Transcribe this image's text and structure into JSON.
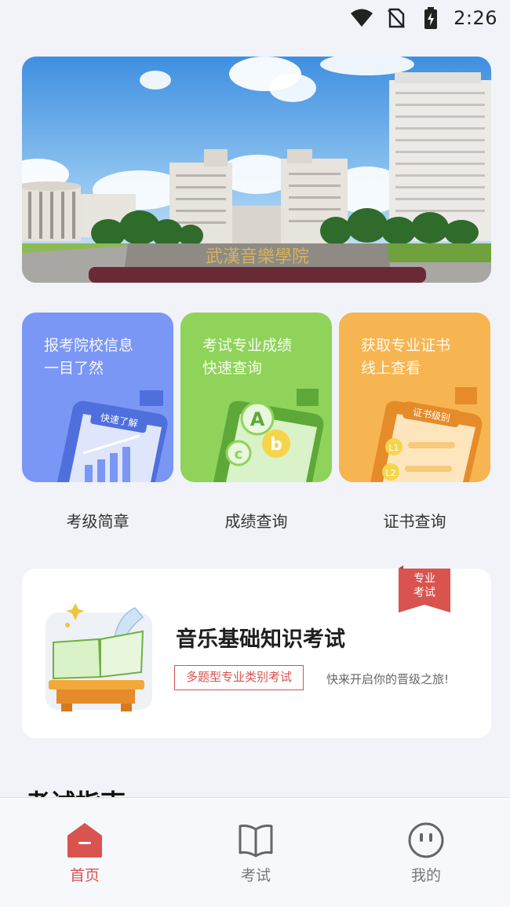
{
  "status_bar": {
    "time": "2:26",
    "icons": [
      "wifi-icon",
      "no-sim-icon",
      "battery-charging-icon"
    ]
  },
  "banner": {
    "sign_text": "武漢音樂學院"
  },
  "feature_cards": [
    {
      "text_line1": "报考院校信息",
      "text_line2": "一目了然",
      "badge": "快速了解",
      "label": "考级简章",
      "color": "#7b97f5"
    },
    {
      "text_line1": "考试专业成绩",
      "text_line2": "快速查询",
      "badge": "",
      "label": "成绩查询",
      "color": "#8fd35a"
    },
    {
      "text_line1": "获取专业证书",
      "text_line2": "线上查看",
      "badge": "证书级别",
      "label": "证书查询",
      "color": "#f6b551"
    }
  ],
  "exam_card": {
    "ribbon_line1": "专业",
    "ribbon_line2": "考试",
    "title": "音乐基础知识考试",
    "tag": "多题型专业类别考试",
    "subtitle": "快来开启你的晋级之旅!"
  },
  "section": {
    "title": "考试指南"
  },
  "tab_bar": {
    "tabs": [
      {
        "label": "首页",
        "icon": "home-icon",
        "active": true
      },
      {
        "label": "考试",
        "icon": "book-icon",
        "active": false
      },
      {
        "label": "我的",
        "icon": "profile-face-icon",
        "active": false
      }
    ],
    "accent": "#d9534f"
  }
}
